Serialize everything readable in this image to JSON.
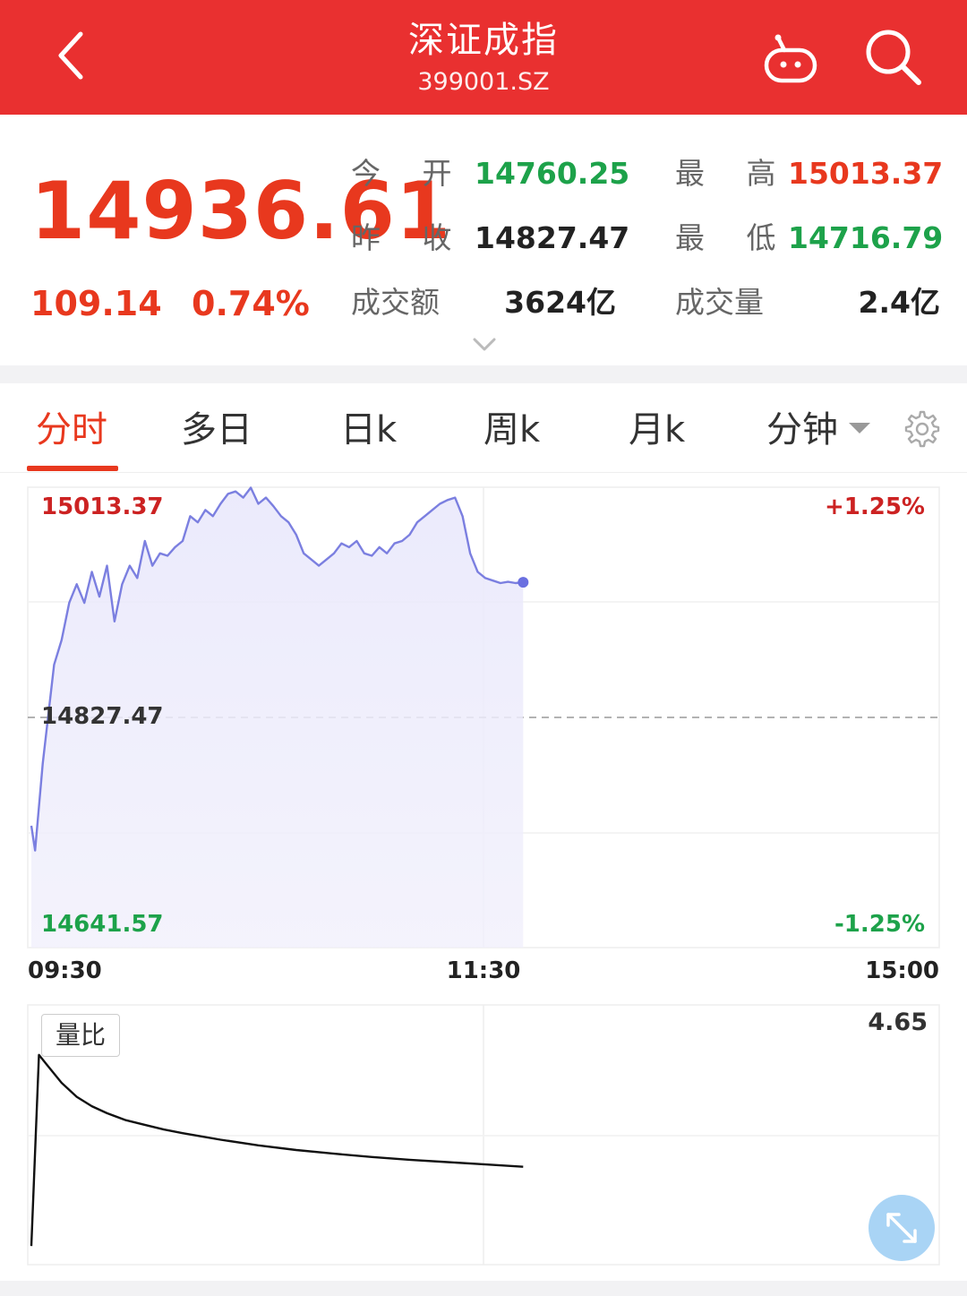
{
  "header": {
    "title": "深证成指",
    "code": "399001.SZ",
    "back_icon": "chevron-left-icon",
    "robot_icon": "robot-icon",
    "search_icon": "search-icon"
  },
  "quote": {
    "price": "14936.61",
    "change": "109.14",
    "change_pct": "0.74%",
    "open_label": "今 开",
    "open_value": "14760.25",
    "high_label": "最 高",
    "high_value": "15013.37",
    "prev_close_label": "昨 收",
    "prev_close_value": "14827.47",
    "low_label": "最 低",
    "low_value": "14716.79",
    "turnover_label": "成交额",
    "turnover_value": "3624亿",
    "volume_label": "成交量",
    "volume_value": "2.4亿"
  },
  "tabs": [
    {
      "label": "分时"
    },
    {
      "label": "多日"
    },
    {
      "label": "日k"
    },
    {
      "label": "周k"
    },
    {
      "label": "月k"
    },
    {
      "label": "分钟"
    }
  ],
  "colors": {
    "up": "#e8381e",
    "down": "#1da24a",
    "header": "#e93030",
    "line": "#7b7fe0"
  },
  "chart_data": [
    {
      "type": "line",
      "y_labels": {
        "top": "15013.37",
        "mid": "14827.47",
        "bottom": "14641.57"
      },
      "pct_labels": {
        "top": "+1.25%",
        "bottom": "-1.25%"
      },
      "x_labels": [
        "09:30",
        "11:30",
        "15:00"
      ],
      "ylim": [
        14641.57,
        15013.37
      ],
      "reference": 14827.47,
      "x_range_minutes": 240,
      "series": [
        {
          "x": [
            0,
            1,
            3,
            6,
            8,
            10,
            12,
            14,
            16,
            18,
            20,
            22,
            24,
            26,
            28,
            30,
            32,
            34,
            36,
            38,
            40,
            42,
            44,
            46,
            48,
            50,
            52,
            54,
            56,
            58,
            60,
            62,
            64,
            66,
            68,
            70,
            72,
            74,
            76,
            78,
            80,
            82,
            84,
            86,
            88,
            90,
            92,
            94,
            96,
            98,
            100,
            102,
            104,
            106,
            108,
            110,
            112,
            114,
            116,
            118,
            120,
            122,
            124,
            126,
            128,
            130
          ],
          "y": [
            14740,
            14720,
            14790,
            14870,
            14890,
            14920,
            14935,
            14920,
            14945,
            14925,
            14950,
            14905,
            14935,
            14950,
            14940,
            14970,
            14950,
            14960,
            14958,
            14965,
            14970,
            14990,
            14985,
            14995,
            14990,
            15000,
            15008,
            15010,
            15005,
            15013,
            15000,
            15005,
            14998,
            14990,
            14985,
            14975,
            14960,
            14955,
            14950,
            14955,
            14960,
            14968,
            14965,
            14970,
            14960,
            14958,
            14965,
            14960,
            14968,
            14970,
            14975,
            14985,
            14990,
            14995,
            15000,
            15003,
            15005,
            14990,
            14960,
            14945,
            14940,
            14938,
            14936,
            14937,
            14936,
            14936.61
          ]
        }
      ]
    },
    {
      "type": "line",
      "title": "量比",
      "max_label": "4.65",
      "ylim": [
        0,
        4.65
      ],
      "x_range_minutes": 240,
      "series": [
        {
          "x": [
            0,
            2,
            4,
            8,
            12,
            16,
            20,
            25,
            30,
            35,
            40,
            50,
            60,
            70,
            80,
            90,
            100,
            110,
            120,
            130
          ],
          "y": [
            0.4,
            4.5,
            4.3,
            3.9,
            3.6,
            3.4,
            3.25,
            3.1,
            3.0,
            2.9,
            2.82,
            2.68,
            2.56,
            2.46,
            2.38,
            2.31,
            2.25,
            2.2,
            2.15,
            2.1
          ]
        }
      ]
    }
  ]
}
